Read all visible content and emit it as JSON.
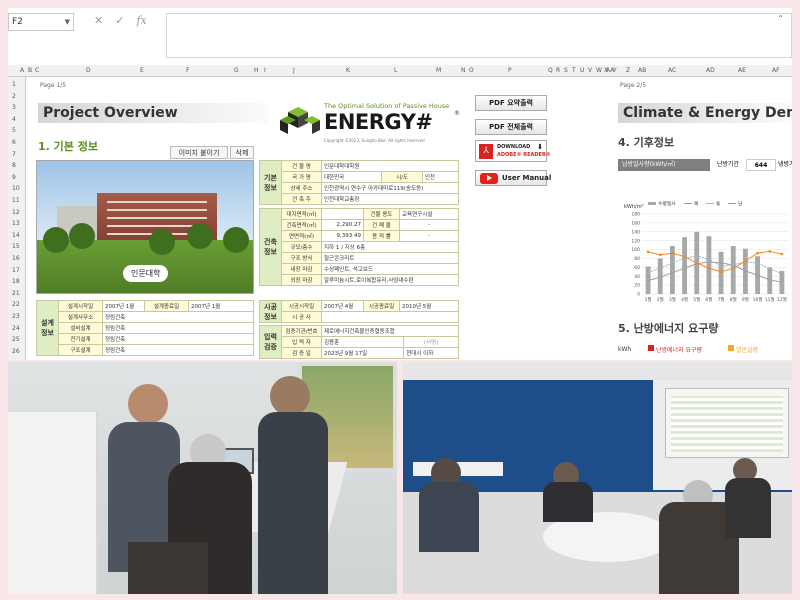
{
  "formula_bar": {
    "name_box": "F2",
    "cancel_icon": "cancel-icon",
    "enter_icon": "check-icon",
    "fx_label": "fx"
  },
  "columns": [
    "A",
    "B",
    "C",
    "D",
    "E",
    "F",
    "G",
    "H",
    "I",
    "J",
    "K",
    "L",
    "M",
    "N",
    "O",
    "P",
    "Q",
    "R",
    "S",
    "T",
    "U",
    "V",
    "W",
    "X",
    "Y",
    "Z",
    "AA",
    "AB",
    "AC",
    "AD",
    "AE",
    "AF"
  ],
  "rows": [
    "1",
    "2",
    "3",
    "4",
    "5",
    "6",
    "7",
    "8",
    "9",
    "10",
    "11",
    "12",
    "13",
    "14",
    "15",
    "16",
    "17",
    "18",
    "21",
    "22",
    "23",
    "24",
    "25",
    "26"
  ],
  "page1": {
    "page_label": "Page 1/5",
    "title": "Project Overview",
    "tagline": "The Optimal Solution of Passive House",
    "logo_text": "ENERGY#",
    "copyright": "Copyright ©2023, Sungho Bae. All rights reserved",
    "section_title": "1. 기본 정보",
    "btn_insert_image": "이미지 붙이기",
    "btn_delete": "삭제",
    "photo_caption": "인문대학",
    "basic_info": {
      "group": [
        "기본",
        "정보"
      ],
      "rows": [
        {
          "label": "건 물 명",
          "value": "인문대학대학원"
        },
        {
          "label": "국 가 명",
          "value": "대한민국",
          "label2": "시/도",
          "value2": "인천"
        },
        {
          "label": "상세 주소",
          "value": "인천광역시 연수구 아카데미로119(송도동)"
        },
        {
          "label": "건 축 주",
          "value": "인천대학교총장"
        }
      ]
    },
    "arch_info": {
      "group": [
        "건축",
        "정보"
      ],
      "rows": [
        {
          "label": "대지면적(㎡)",
          "value": "",
          "label2": "건물 용도",
          "value2": "교육연구시설"
        },
        {
          "label": "건축면적(㎡)",
          "value": "2,290.27",
          "label2": "건 폐 율",
          "value2": "-"
        },
        {
          "label": "연면적(㎡)",
          "value": "9,393.49",
          "label2": "용 적 률",
          "value2": "-"
        },
        {
          "label": "규모/층수",
          "value": "지하 1 / 지상 6층"
        },
        {
          "label": "구조 방식",
          "value": "철근콘크리트"
        },
        {
          "label": "내장 마감",
          "value": "수성페인트, 석고보드"
        },
        {
          "label": "외장 마감",
          "value": "알루미늄시트,로이복합유리,사암내수판"
        }
      ]
    },
    "design_info": {
      "group": [
        "설계",
        "정보"
      ],
      "rows": [
        {
          "label": "설계시작일",
          "value": "2007년 1월",
          "label2": "설계종료일",
          "value2": "2007년 1월"
        },
        {
          "label": "설계사무소",
          "value": "정림건축"
        },
        {
          "label": "설비설계",
          "value": "정림건축"
        },
        {
          "label": "전기설계",
          "value": "정림건축"
        },
        {
          "label": "구조설계",
          "value": "정림건축"
        }
      ]
    },
    "construction_info": {
      "group": [
        "시공",
        "정보"
      ],
      "rows": [
        {
          "label": "시공시작일",
          "value": "2007년 4월",
          "label2": "시공종료일",
          "value2": "2010년 5월"
        },
        {
          "label": "시 공 사",
          "value": ""
        }
      ]
    },
    "input_info": {
      "group": [
        "입력",
        "검증"
      ],
      "rows": [
        {
          "label": "검증기관/번호",
          "value": "제로에너지건축물인증협동조합"
        },
        {
          "label": "입 력 자",
          "value": "김용훈",
          "value2": "(서명)"
        },
        {
          "label": "검 증 일",
          "value": "2023년 9월 17일",
          "value2": "현대시 이하"
        }
      ]
    }
  },
  "side_buttons": {
    "pdf_summary": "PDF 요약출력",
    "pdf_all": "PDF 전체출력",
    "adobe_download": "DOWNLOAD",
    "adobe_reader": "ADOBE® READER®",
    "user_manual": "User Manual"
  },
  "page2": {
    "page_label": "Page 2/5",
    "title": "Climate & Energy Dema",
    "section4": "4. 기후정보",
    "heating_days_label": "남방일사량(kWh/㎡)",
    "heating_period_label": "난방기간",
    "heating_period_value": "644",
    "cooling_period_label": "냉방기간",
    "section5": "5. 난방에너지 요구량",
    "energy_unit": "kWh",
    "legend_heating": "난방에너지 요구량",
    "legend_loss": "열손실량"
  },
  "chart_data": {
    "type": "bar",
    "ylabel": "kWh/m²",
    "ylim": [
      0,
      180
    ],
    "yticks": [
      0,
      20,
      40,
      60,
      80,
      100,
      120,
      140,
      160,
      180
    ],
    "categories": [
      "1월",
      "2월",
      "3월",
      "4월",
      "5월",
      "6월",
      "7월",
      "8월",
      "9월",
      "10월",
      "11월",
      "12월"
    ],
    "series": [
      {
        "name": "수평일사",
        "kind": "bar",
        "color": "#a8a8a8",
        "values": [
          62,
          80,
          108,
          128,
          140,
          130,
          95,
          108,
          102,
          85,
          60,
          52
        ]
      },
      {
        "name": "북",
        "kind": "line",
        "color": "#9e9e9e",
        "values": [
          30,
          38,
          48,
          58,
          68,
          72,
          70,
          65,
          52,
          42,
          32,
          26
        ]
      },
      {
        "name": "동",
        "kind": "line",
        "color": "#8db7d6",
        "values": [
          48,
          58,
          70,
          80,
          86,
          78,
          62,
          66,
          72,
          70,
          56,
          46
        ]
      },
      {
        "name": "남",
        "kind": "line",
        "color": "#f08a1c",
        "values": [
          95,
          88,
          92,
          84,
          70,
          58,
          50,
          58,
          74,
          92,
          96,
          90
        ]
      }
    ],
    "legend": "top"
  },
  "photos": {
    "left_alt": "Seniors gathered around a laptop in an office",
    "right_alt": "Seminar room with projector screen showing spreadsheet"
  }
}
